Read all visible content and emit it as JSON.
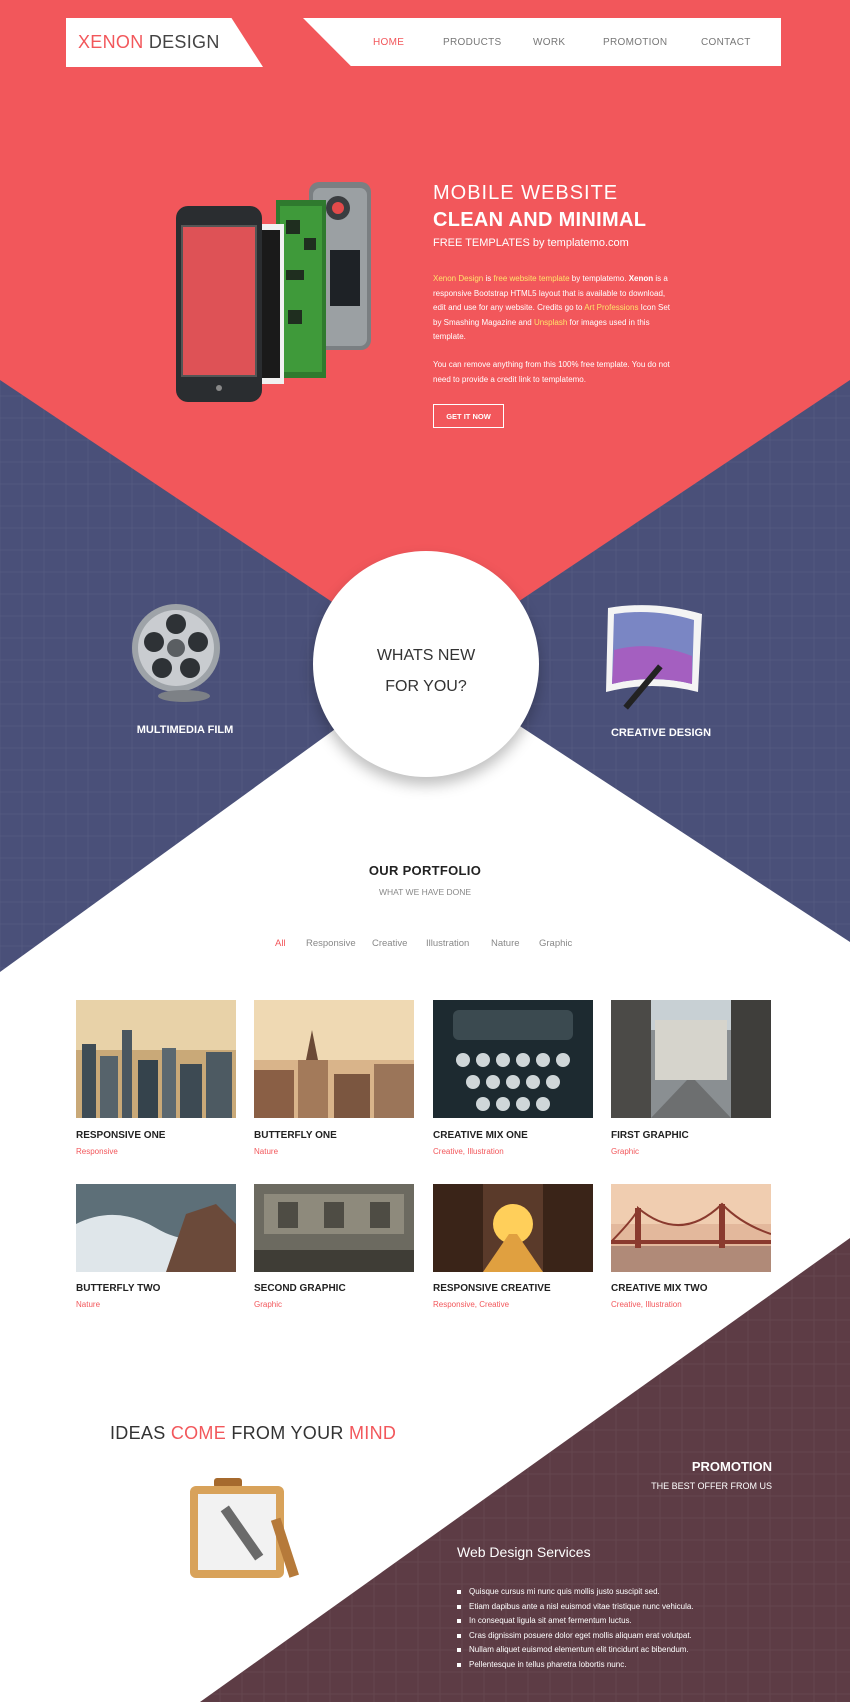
{
  "colors": {
    "accent": "#f2575b",
    "navy": "#4a5079",
    "wine": "#5d3c45",
    "yellow": "#ffe36b"
  },
  "logo": {
    "part1": "XENON",
    "part2": " DESIGN"
  },
  "nav": {
    "items": [
      "HOME",
      "PRODUCTS",
      "WORK",
      "PROMOTION",
      "CONTACT"
    ],
    "active": "HOME"
  },
  "hero": {
    "title1": "MOBILE WEBSITE",
    "title2": "CLEAN AND MINIMAL",
    "subtitle": "FREE TEMPLATES by templatemo.com",
    "p1": {
      "xenon_design": "Xenon Design",
      "is": " is ",
      "free_template": "free website template",
      "by": " by templatemo. ",
      "xenon": "Xenon",
      "rest1": " is a responsive Bootstrap HTML5 layout that is available to download, edit and use for any website. Credits go to ",
      "art": "Art Professions",
      "rest2": " Icon Set by Smashing Magazine and ",
      "unsplash": "Unsplash",
      "rest3": " for images used in this template."
    },
    "p2": "You can remove anything from this 100% free template. You do not need to provide a credit link to templatemo.",
    "button": "GET IT NOW"
  },
  "features": {
    "left": "MULTIMEDIA FILM",
    "center_line1": "WHATS NEW",
    "center_line2": "FOR YOU?",
    "right": "CREATIVE DESIGN"
  },
  "portfolio": {
    "title": "OUR PORTFOLIO",
    "subtitle": "WHAT WE HAVE DONE",
    "filters": [
      "All",
      "Responsive",
      "Creative",
      "Illustration",
      "Nature",
      "Graphic"
    ],
    "active_filter": "All",
    "items": [
      {
        "title": "RESPONSIVE ONE",
        "category": "Responsive",
        "image": "city-skyline"
      },
      {
        "title": "BUTTERFLY ONE",
        "category": "Nature",
        "image": "city-rooftops"
      },
      {
        "title": "CREATIVE MIX ONE",
        "category": "Creative, Illustration",
        "image": "typewriter"
      },
      {
        "title": "FIRST GRAPHIC",
        "category": "Graphic",
        "image": "street"
      },
      {
        "title": "BUTTERFLY TWO",
        "category": "Nature",
        "image": "sea-rocks"
      },
      {
        "title": "SECOND GRAPHIC",
        "category": "Graphic",
        "image": "old-building"
      },
      {
        "title": "RESPONSIVE CREATIVE",
        "category": "Responsive, Creative",
        "image": "sunset-street"
      },
      {
        "title": "CREATIVE MIX TWO",
        "category": "Creative, Illustration",
        "image": "bridge"
      }
    ]
  },
  "ideas": {
    "w1": "IDEAS ",
    "w2": "COME",
    "w3": " FROM YOUR ",
    "w4": "MIND"
  },
  "promotion": {
    "title": "PROMOTION",
    "subtitle": "THE BEST OFFER FROM US",
    "services_title": "Web Design Services",
    "services": [
      "Quisque cursus mi nunc quis mollis justo suscipit sed.",
      "Etiam dapibus ante a nisl euismod vitae tristique nunc vehicula.",
      "In consequat ligula sit amet fermentum luctus.",
      "Cras dignissim posuere dolor eget mollis aliquam erat volutpat.",
      "Nullam aliquet euismod elementum elit tincidunt ac bibendum.",
      "Pellentesque in tellus pharetra lobortis nunc."
    ]
  }
}
